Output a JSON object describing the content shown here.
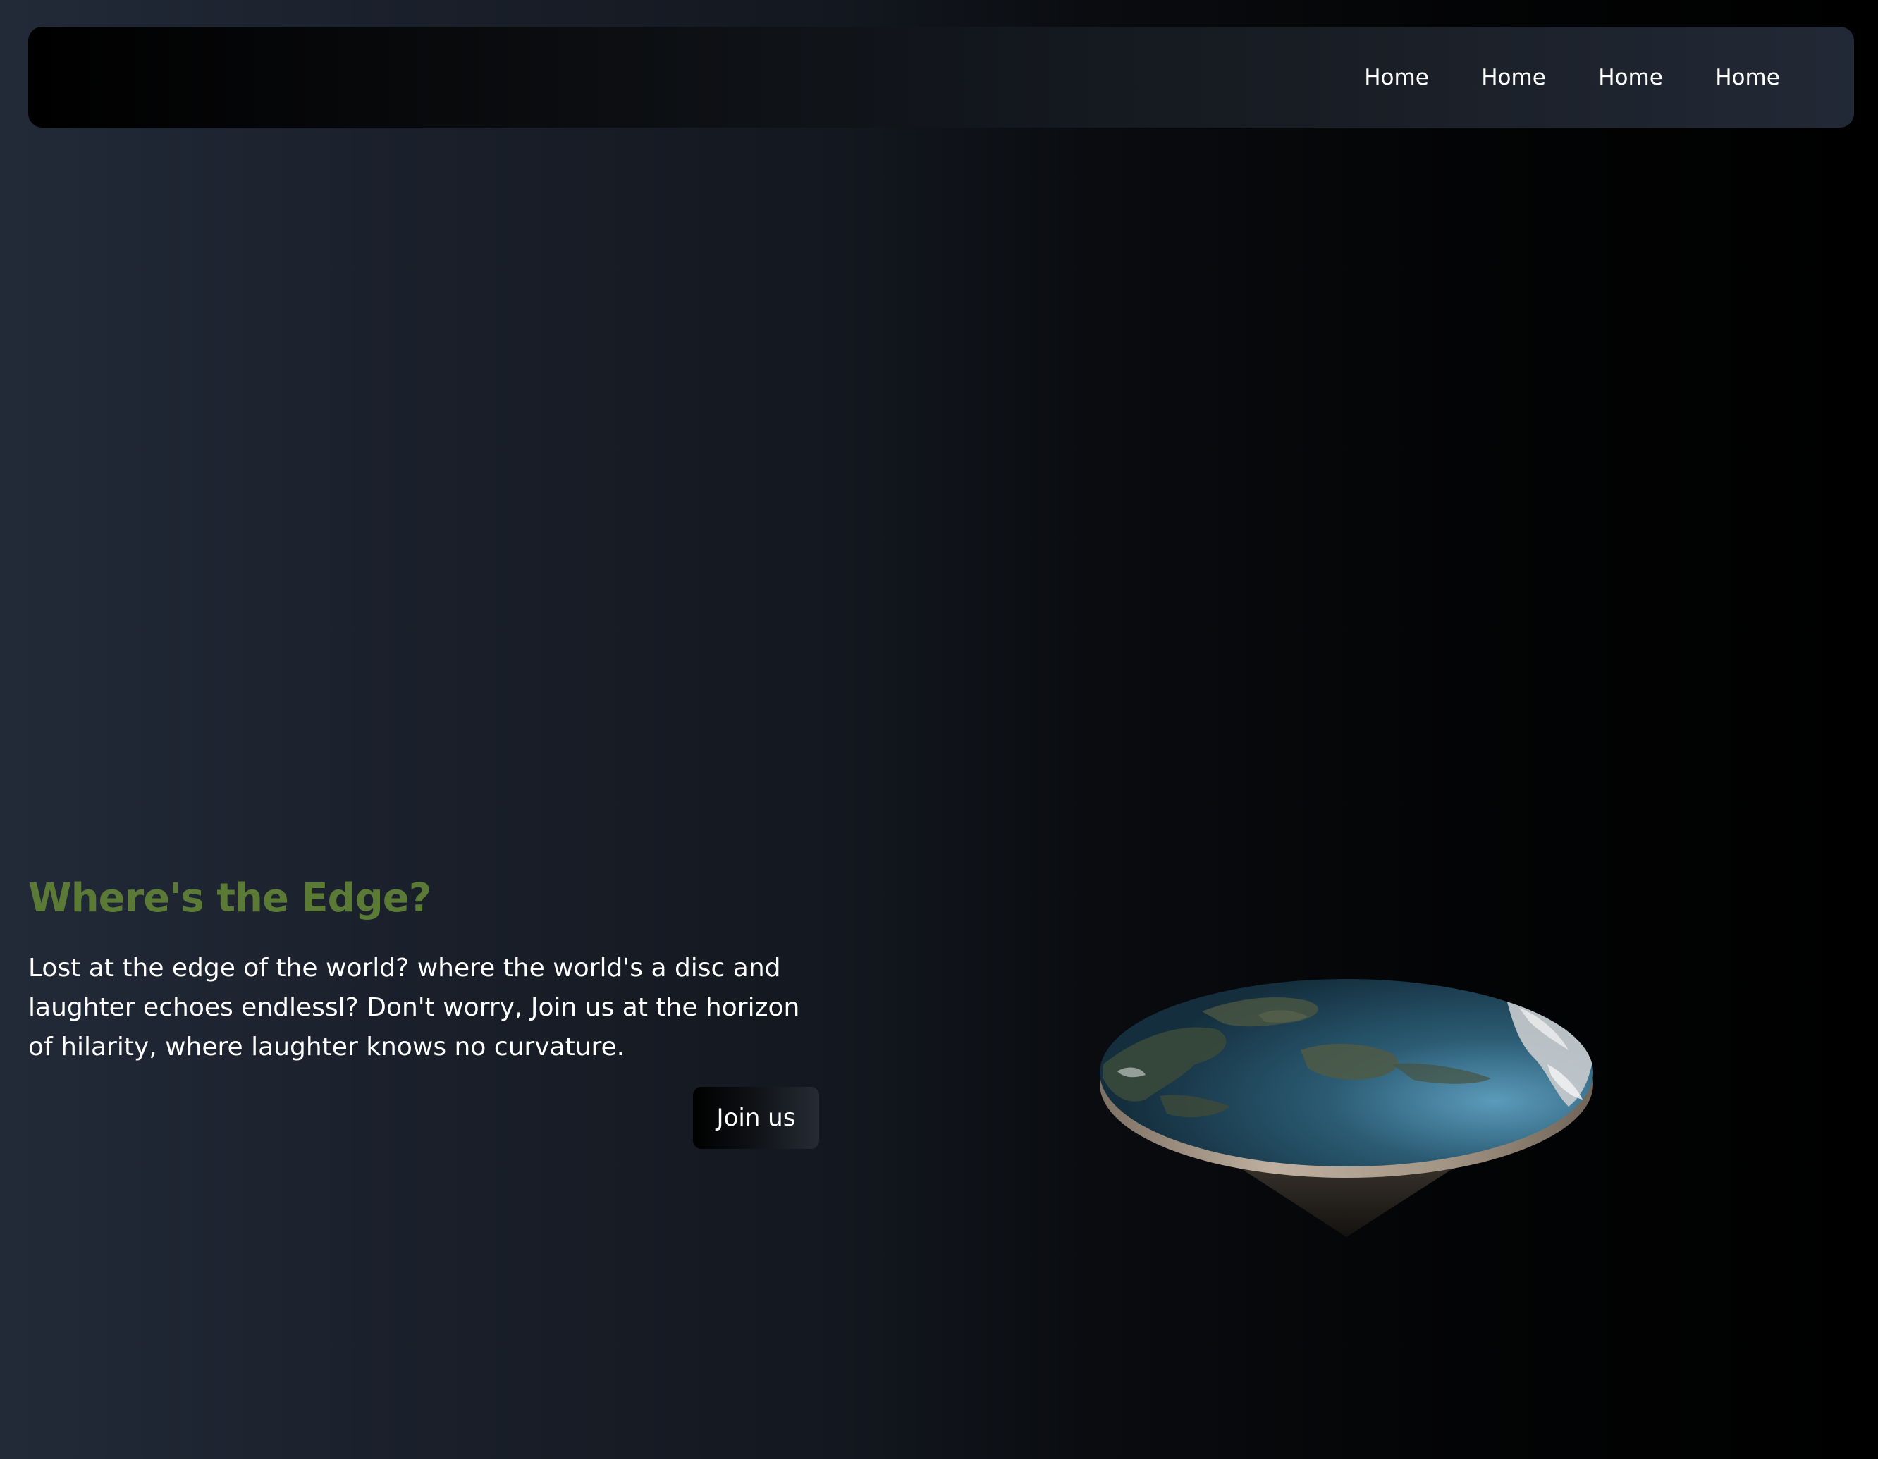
{
  "nav": {
    "links": [
      "Home",
      "Home",
      "Home",
      "Home"
    ]
  },
  "hero": {
    "title": "Where's the Edge?",
    "text": "Lost at the edge of the world? where the world's a disc and laughter echoes endlessl? Don't worry, Join us at the horizon of hilarity, where laughter knows no curvature.",
    "button_label": "Join us"
  },
  "colors": {
    "accent": "#5a7a35",
    "background_left": "#222a38",
    "background_right": "#000000"
  }
}
